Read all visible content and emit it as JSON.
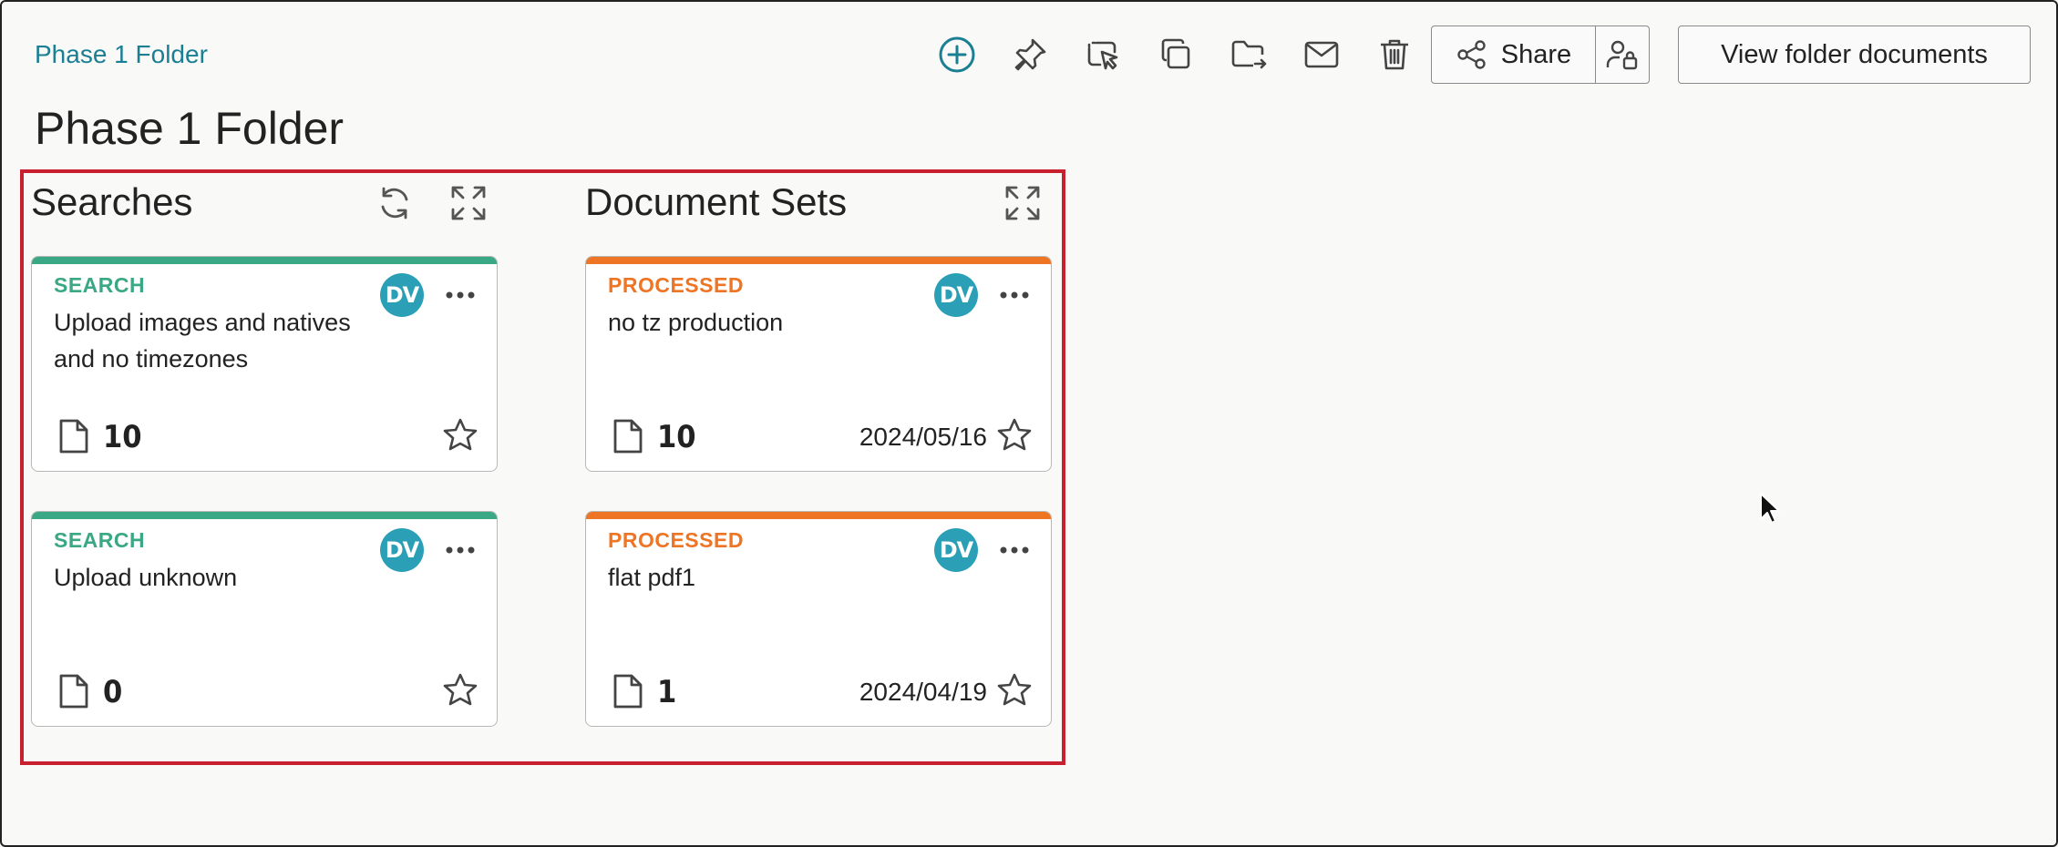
{
  "breadcrumb": {
    "label": "Phase 1 Folder"
  },
  "page": {
    "title": "Phase 1 Folder"
  },
  "toolbar": {
    "icons": [
      "add-circle-icon",
      "pin-icon",
      "select-cursor-icon",
      "copy-icon",
      "move-folder-icon",
      "mail-icon",
      "trash-icon"
    ],
    "share_label": "Share",
    "view_docs_label": "View folder documents"
  },
  "colors": {
    "accent": "#1a7f93",
    "search": "#3aa884",
    "processed": "#ee7524",
    "avatar": "#2a9fb6",
    "highlight": "#c8202e"
  },
  "searches": {
    "title": "Searches",
    "cards": [
      {
        "kind": "SEARCH",
        "name": "Upload images and natives and no timezones",
        "avatar": "DV",
        "count": "10"
      },
      {
        "kind": "SEARCH",
        "name": "Upload unknown",
        "avatar": "DV",
        "count": "0"
      }
    ]
  },
  "document_sets": {
    "title": "Document Sets",
    "cards": [
      {
        "kind": "PROCESSED",
        "name": "no tz production",
        "avatar": "DV",
        "count": "10",
        "date": "2024/05/16"
      },
      {
        "kind": "PROCESSED",
        "name": "flat pdf1",
        "avatar": "DV",
        "count": "1",
        "date": "2024/04/19"
      }
    ]
  }
}
